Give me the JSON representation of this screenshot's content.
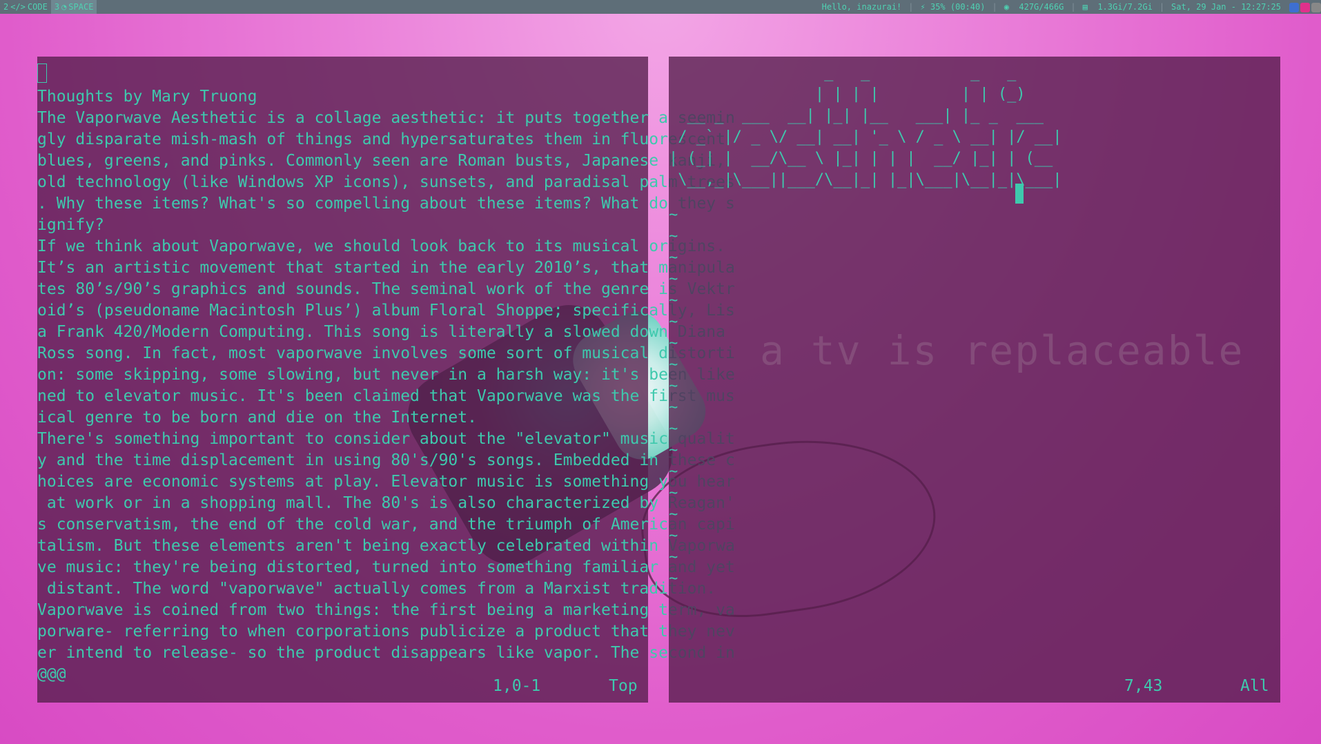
{
  "topbar": {
    "workspaces": [
      {
        "num": "2",
        "icon": "code-icon",
        "label": "CODE",
        "active": false
      },
      {
        "num": "3",
        "icon": "globe-icon",
        "label": "SPACE",
        "active": true
      }
    ],
    "greeting": "Hello, inazurai!",
    "battery": "35% (00:40)",
    "disk": "427G/466G",
    "memory": "1.3Gi/7.2Gi",
    "datetime": "Sat, 29 Jan - 12:27:25"
  },
  "left_pane": {
    "lines": [
      "Thoughts by Mary Truong",
      "The Vaporwave Aesthetic is a collage aesthetic: it puts together a seemin",
      "gly disparate mish-mash of things and hypersaturates them in fluorescent",
      "blues, greens, and pinks. Commonly seen are Roman busts, Japanese kanji,",
      "old technology (like Windows XP icons), sunsets, and paradisal palm trees",
      ". Why these items? What's so compelling about these items? What do they s",
      "ignify?",
      "If we think about Vaporwave, we should look back to its musical origins.",
      "It’s an artistic movement that started in the early 2010’s, that manipula",
      "tes 80’s/90’s graphics and sounds. The seminal work of the genre is Vektr",
      "oid’s (pseudoname Macintosh Plus’) album Floral Shoppe; specifically, Lis",
      "a Frank 420/Modern Computing. This song is literally a slowed down Diana",
      "Ross song. In fact, most vaporwave involves some sort of musical distorti",
      "on: some skipping, some slowing, but never in a harsh way: it's been like",
      "ned to elevator music. It's been claimed that Vaporwave was the first mus",
      "ical genre to be born and die on the Internet.",
      "There's something important to consider about the \"elevator\" music qualit",
      "y and the time displacement in using 80's/90's songs. Embedded in these c",
      "hoices are economic systems at play. Elevator music is something you hear",
      " at work or in a shopping mall. The 80's is also characterized by Reagan'",
      "s conservatism, the end of the cold war, and the triumph of American capi",
      "talism. But these elements aren't being exactly celebrated within Vaporwa",
      "ve music: they're being distorted, turned into something familiar and yet",
      " distant. The word \"vaporwave\" actually comes from a Marxist tradition.",
      "Vaporwave is coined from two things: the first being a marketing term, va",
      "porware- referring to when corporations publicize a product that they nev",
      "er intend to release- so the product disappears like vapor. The second in",
      "@@@"
    ],
    "status_pos": "1,0-1",
    "status_scroll": "Top"
  },
  "right_pane": {
    "ascii_art": [
      "                 _   _           _   _",
      "                | | | |         | | (_)",
      "  __ _  ___  __| |_| |__   ___| |_ _  ___",
      " / _` |/ _ \\/ __| __| '_ \\ / _ \\ __| |/ __|",
      "| (_| |  __/\\__ \\ |_| | | |  __/ |_| | (__",
      " \\__,_|\\___||___/\\__|_| |_|\\___|\\__|_|\\___|"
    ],
    "tilde": "~",
    "tilde_count": 18,
    "status_pos": "7,43",
    "status_scroll": "All"
  },
  "wallpaper": {
    "tagline": "a tv is replaceable"
  }
}
